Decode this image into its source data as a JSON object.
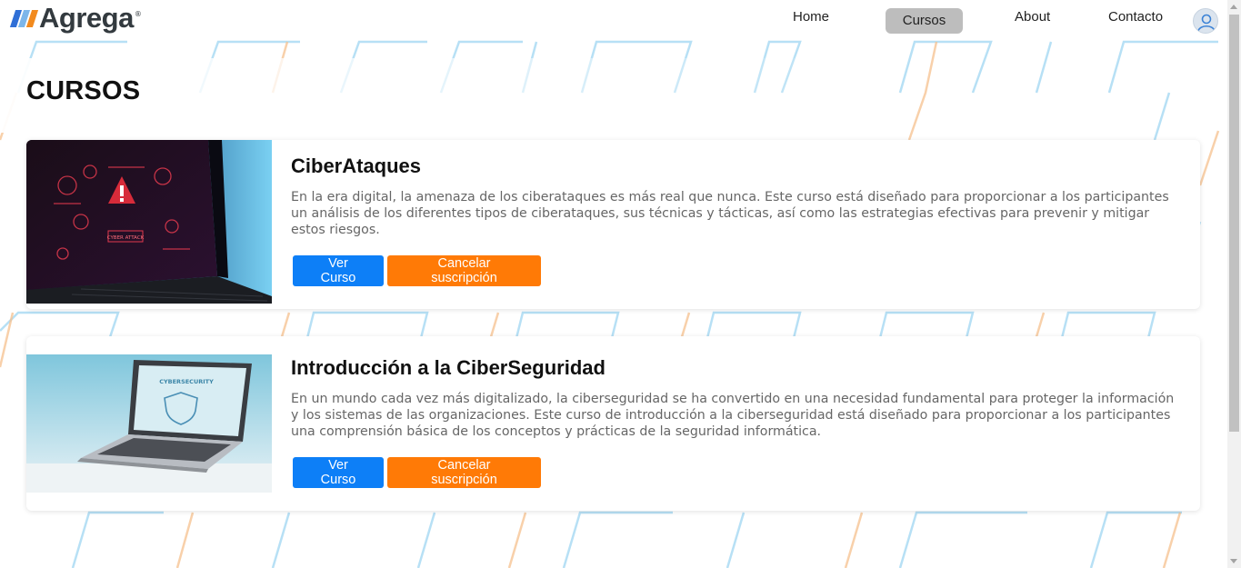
{
  "brand": {
    "name": "Agrega",
    "reg": "®",
    "colors": {
      "stripe1": "#2f6fd6",
      "stripe2": "#5ba3e8",
      "stripe3": "#f28a1e",
      "text": "#333a3f"
    }
  },
  "nav": {
    "items": [
      {
        "label": "Home",
        "active": false
      },
      {
        "label": "Cursos",
        "active": true
      },
      {
        "label": "About",
        "active": false
      },
      {
        "label": "Contacto",
        "active": false
      }
    ],
    "avatar_icon": "user-avatar-icon"
  },
  "page": {
    "title": "CURSOS"
  },
  "courses": [
    {
      "title": "CiberAtaques",
      "description": "En la era digital, la amenaza de los ciberataques es más real que nunca. Este curso está diseñado para proporcionar a los participantes un análisis de los diferentes tipos de ciberataques, sus técnicas y tácticas, así como las estrategias efectivas para prevenir y mitigar estos riesgos.",
      "image_text": "CYBER ATTACK",
      "view_label": "Ver Curso",
      "cancel_label": "Cancelar suscripción"
    },
    {
      "title": "Introducción a la CiberSeguridad",
      "description": "En un mundo cada vez más digitalizado, la ciberseguridad se ha convertido en una necesidad fundamental para proteger la información y los sistemas de las organizaciones. Este curso de introducción a la ciberseguridad está diseñado para proporcionar a los participantes una comprensión básica de los conceptos y prácticas de la seguridad informática.",
      "image_text": "CYBERSECURITY",
      "view_label": "Ver Curso",
      "cancel_label": "Cancelar suscripción"
    }
  ],
  "colors": {
    "primary_button": "#0d7ff7",
    "warning_button": "#ff7a06",
    "active_nav": "#bdbdbd",
    "pattern_blue": "#8fd0f0",
    "pattern_orange": "#f7c79a"
  }
}
